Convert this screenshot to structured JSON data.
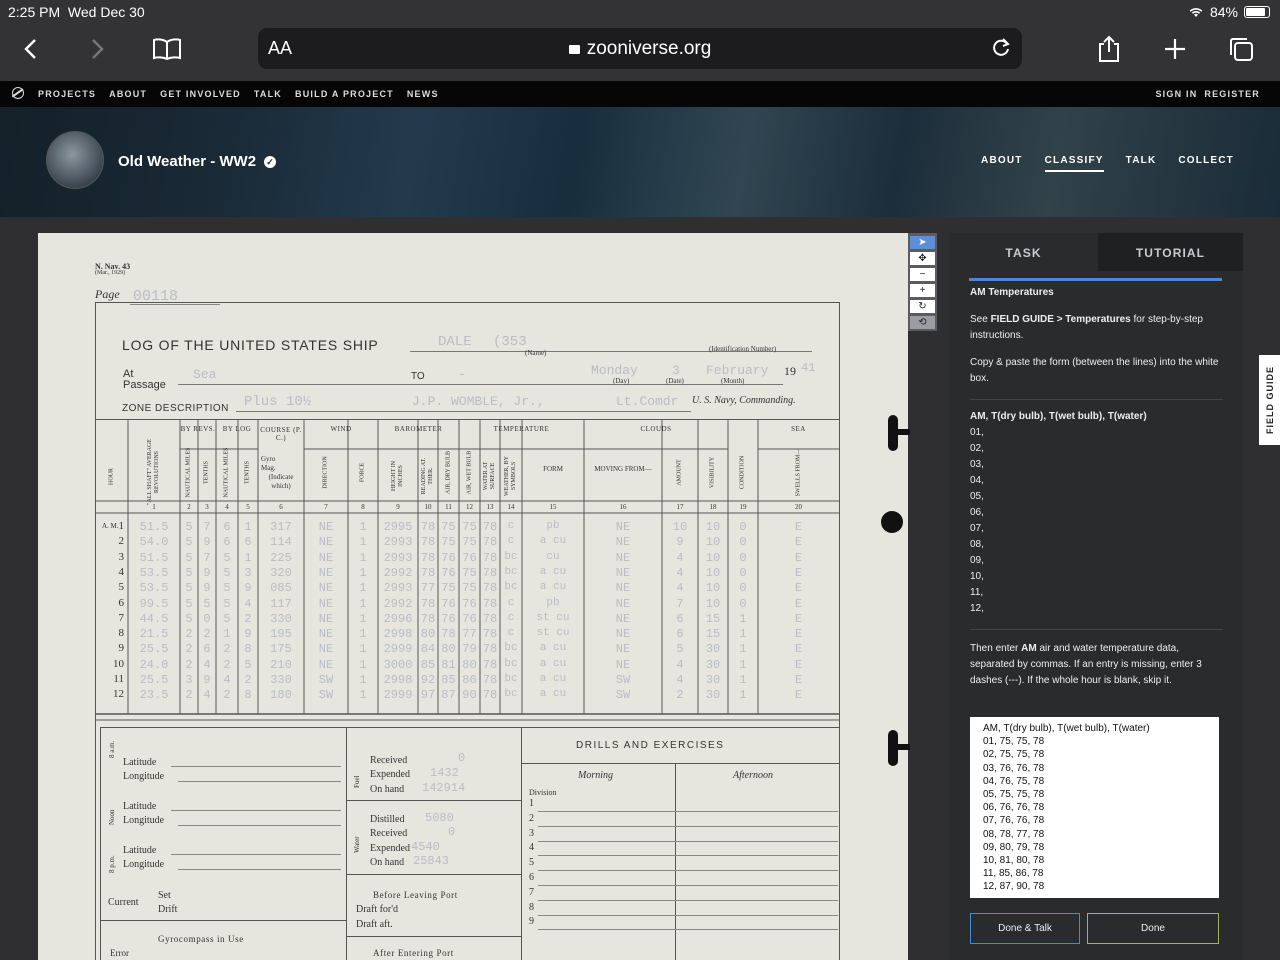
{
  "status": {
    "time": "2:25 PM",
    "date": "Wed Dec 30",
    "battery": "84%"
  },
  "browser": {
    "text_size_label": "AA",
    "url": "zooniverse.org"
  },
  "zoo_nav": {
    "items": [
      "PROJECTS",
      "ABOUT",
      "GET INVOLVED",
      "TALK",
      "BUILD A PROJECT",
      "NEWS"
    ],
    "sign_in": "SIGN IN",
    "register": "REGISTER"
  },
  "project": {
    "title": "Old Weather - WW2",
    "nav": [
      "ABOUT",
      "CLASSIFY",
      "TALK",
      "COLLECT"
    ],
    "active_nav": "CLASSIFY"
  },
  "task_panel": {
    "tab_task": "TASK",
    "tab_tutorial": "TUTORIAL",
    "heading": "AM Temperatures",
    "guide_pre": "See ",
    "guide_bold": "FIELD GUIDE > Temperatures",
    "guide_post": " for step-by-step instructions.",
    "copy_text": "Copy & paste the form (between the lines) into the white box.",
    "form_header": "AM, T(dry bulb), T(wet bulb), T(water)",
    "form_rows": [
      "01,",
      "02,",
      "03,",
      "04,",
      "05,",
      "06,",
      "07,",
      "08,",
      "09,",
      "10,",
      "11,",
      "12,"
    ],
    "then_pre": "Then enter ",
    "then_bold": "AM",
    "then_post": " air and water temperature data, separated by commas. If an entry is missing, enter 3 dashes (---). If the whole hour is blank, skip it.",
    "answer_text": "AM, T(dry bulb), T(wet bulb), T(water)\n01, 75, 75, 78\n02, 75, 75, 78\n03, 76, 76, 78\n04, 76, 75, 78\n05, 75, 75, 78\n06, 76, 76, 78\n07, 76, 76, 78\n08, 78, 77, 78\n09, 80, 79, 78\n10, 81, 80, 78\n11, 85, 86, 78\n12, 87, 90, 78",
    "done_talk": "Done & Talk",
    "done": "Done"
  },
  "field_guide_label": "FIELD GUIDE",
  "log": {
    "form_id": "N. Nav. 43",
    "form_date": "(Mar., 1929)",
    "page_label": "Page",
    "page_number": "00118",
    "title": "LOG OF THE UNITED STATES SHIP",
    "ship_name": "DALE",
    "ship_number": "(353",
    "name_caption": "(Name)",
    "id_caption": "(Identification Number)",
    "at_label": "At",
    "passage_label": "Passage",
    "at_value": "Sea",
    "to_label": "TO",
    "to_value": "-",
    "day_value": "Monday",
    "date_value": "3",
    "month_value": "February",
    "year_prefix": "19",
    "year_suffix": "41",
    "day_caption": "(Day)",
    "date_caption": "(Date)",
    "month_caption": "(Month)",
    "zone_label": "ZONE DESCRIPTION",
    "zone_value": "Plus 10½",
    "commander": "J.P. WOMBLE, Jr.,",
    "rank": "Lt.Comdr",
    "navy_label": "U. S. Navy, Commanding.",
    "group_headers": [
      "BY REVS.",
      "BY LOG",
      "COURSE (P. C.)",
      "WIND",
      "BAROMETER",
      "TEMPERATURE",
      "CLOUDS",
      "SEA"
    ],
    "col_headers": [
      "HOUR",
      "\"ALL SHAFT\" AVERAGE REVOLUTIONS",
      "NAUTICAL MILES",
      "TENTHS",
      "NAUTICAL MILES",
      "TENTHS",
      "COURSE",
      "DIRECTION",
      "FORCE",
      "HEIGHT IN INCHES",
      "READING AT. THER.",
      "AIR, DRY BULB",
      "AIR, WET BULB",
      "WATER AT SURFACE",
      "WEATHER, BY SYMBOLS",
      "FORM",
      "MOVING FROM—",
      "AMOUNT",
      "VISIBILITY",
      "CONDITION",
      "SWELLS FROM—"
    ],
    "col_numbers": [
      "",
      "1",
      "2",
      "3",
      "4",
      "5",
      "6",
      "7",
      "8",
      "9",
      "10",
      "11",
      "12",
      "13",
      "14",
      "15",
      "16",
      "17",
      "18",
      "19",
      "20"
    ],
    "course_sub": [
      "Gyro",
      "Mag.",
      "(Indicate which)"
    ],
    "am_label": "A. M.",
    "rows": [
      [
        "1",
        "51.5",
        "5",
        "7",
        "6",
        "1",
        "317",
        "NE",
        "1",
        "2995",
        "78",
        "75",
        "75",
        "78",
        "c",
        "pb",
        "NE",
        "10",
        "10",
        "0",
        "E"
      ],
      [
        "2",
        "54.0",
        "5",
        "9",
        "6",
        "6",
        "114",
        "NE",
        "1",
        "2993",
        "78",
        "75",
        "75",
        "78",
        "c",
        "a cu",
        "NE",
        "9",
        "10",
        "0",
        "E"
      ],
      [
        "3",
        "51.5",
        "5",
        "7",
        "5",
        "1",
        "225",
        "NE",
        "1",
        "2993",
        "78",
        "76",
        "76",
        "78",
        "bc",
        "cu",
        "NE",
        "4",
        "10",
        "0",
        "E"
      ],
      [
        "4",
        "53.5",
        "5",
        "9",
        "5",
        "3",
        "320",
        "NE",
        "1",
        "2992",
        "78",
        "76",
        "75",
        "78",
        "bc",
        "a cu",
        "NE",
        "4",
        "10",
        "0",
        "E"
      ],
      [
        "5",
        "53.5",
        "5",
        "9",
        "5",
        "9",
        "085",
        "NE",
        "1",
        "2993",
        "77",
        "75",
        "75",
        "78",
        "bc",
        "a cu",
        "NE",
        "4",
        "10",
        "0",
        "E"
      ],
      [
        "6",
        "99.5",
        "5",
        "5",
        "5",
        "4",
        "117",
        "NE",
        "1",
        "2992",
        "78",
        "76",
        "76",
        "78",
        "c",
        "pb",
        "NE",
        "7",
        "10",
        "0",
        "E"
      ],
      [
        "7",
        "44.5",
        "5",
        "0",
        "5",
        "2",
        "330",
        "NE",
        "1",
        "2996",
        "78",
        "76",
        "76",
        "78",
        "c",
        "st cu",
        "NE",
        "6",
        "15",
        "1",
        "E"
      ],
      [
        "8",
        "21.5",
        "2",
        "2",
        "1",
        "9",
        "195",
        "NE",
        "1",
        "2998",
        "80",
        "78",
        "77",
        "78",
        "c",
        "st cu",
        "NE",
        "6",
        "15",
        "1",
        "E"
      ],
      [
        "9",
        "25.5",
        "2",
        "6",
        "2",
        "8",
        "175",
        "NE",
        "1",
        "2999",
        "84",
        "80",
        "79",
        "78",
        "bc",
        "a cu",
        "NE",
        "5",
        "30",
        "1",
        "E"
      ],
      [
        "10",
        "24.0",
        "2",
        "4",
        "2",
        "5",
        "210",
        "NE",
        "1",
        "3000",
        "85",
        "81",
        "80",
        "78",
        "bc",
        "a cu",
        "NE",
        "4",
        "30",
        "1",
        "E"
      ],
      [
        "11",
        "25.5",
        "3",
        "9",
        "4",
        "2",
        "330",
        "SW",
        "1",
        "2998",
        "92",
        "85",
        "86",
        "78",
        "bc",
        "a cu",
        "SW",
        "4",
        "30",
        "1",
        "E"
      ],
      [
        "12",
        "23.5",
        "2",
        "4",
        "2",
        "8",
        "180",
        "SW",
        "1",
        "2999",
        "97",
        "87",
        "90",
        "78",
        "bc",
        "a cu",
        "SW",
        "2",
        "30",
        "1",
        "E"
      ]
    ],
    "lat_label": "Latitude",
    "lon_label": "Longitude",
    "section_labels": [
      "8 a.m.",
      "Noon",
      "8 p.m."
    ],
    "current_label": "Current",
    "set_label": "Set",
    "drift_label": "Drift",
    "gyro_label": "Gyrocompass in Use",
    "error_label": "Error",
    "fuel_label": "Fuel",
    "received_label": "Received",
    "expended_label": "Expended",
    "onhand_label": "On hand",
    "fuel_received": "0",
    "fuel_expended": "1432",
    "fuel_onhand": "142914",
    "water_label": "Water",
    "distilled_label": "Distilled",
    "water_distilled": "5080",
    "water_received": "0",
    "water_expended": "4540",
    "water_onhand": "25843",
    "before_port": "Before Leaving Port",
    "draft_fwd": "Draft for'd",
    "draft_aft": "Draft aft.",
    "after_port": "After Entering Port",
    "drills_title": "DRILLS AND EXERCISES",
    "morning": "Morning",
    "afternoon": "Afternoon",
    "division": "Division",
    "division_numbers": [
      "1",
      "2",
      "3",
      "4",
      "5",
      "6",
      "7",
      "8",
      "9"
    ]
  }
}
